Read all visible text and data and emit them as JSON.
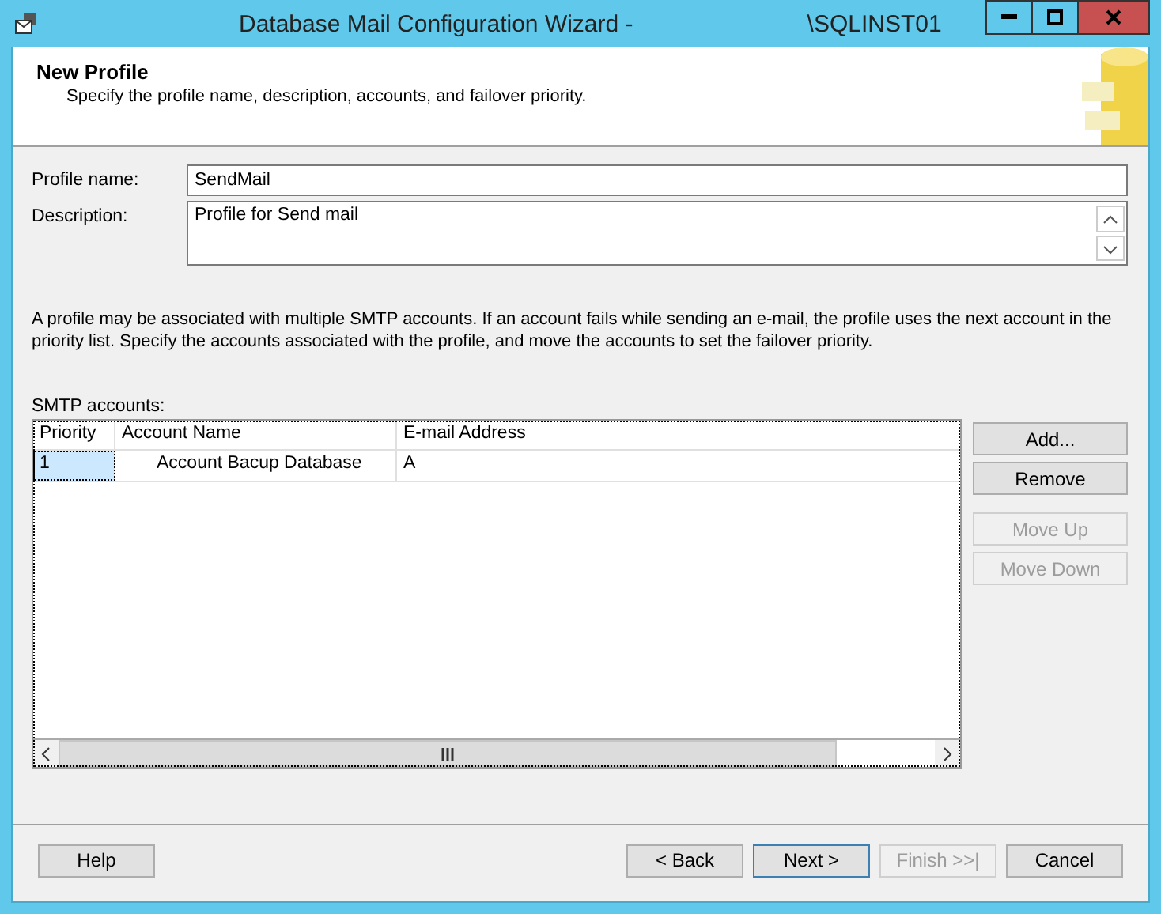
{
  "window": {
    "title": "Database Mail Configuration Wizard -",
    "server": "\\SQLINST01"
  },
  "header": {
    "title": "New Profile",
    "subtitle": "Specify the profile name, description, accounts, and failover priority."
  },
  "form": {
    "profile_name": {
      "label": "Profile name:",
      "value": "SendMail"
    },
    "description": {
      "label": "Description:",
      "value": "Profile for Send mail"
    }
  },
  "info_text": "A profile may be associated with multiple SMTP accounts. If an account fails while sending an e-mail, the profile uses the next account in the priority list. Specify the accounts associated with the profile, and move the accounts to set the failover priority.",
  "smtp_accounts": {
    "label": "SMTP accounts:",
    "columns": [
      "Priority",
      "Account Name",
      "E-mail Address"
    ],
    "rows": [
      {
        "priority": "1",
        "account_name": "Account Bacup Database",
        "email": "A",
        "selected": true
      }
    ],
    "buttons": [
      {
        "label": "Add...",
        "disabled": false
      },
      {
        "label": "Remove",
        "disabled": false
      },
      {
        "label": "Move Up",
        "disabled": true
      },
      {
        "label": "Move Down",
        "disabled": true
      }
    ]
  },
  "footer_buttons": [
    {
      "label": "Help",
      "disabled": false,
      "default": false
    },
    {
      "label": "< Back",
      "disabled": false,
      "default": false
    },
    {
      "label": "Next >",
      "disabled": false,
      "default": true
    },
    {
      "label": "Finish >>|",
      "disabled": true,
      "default": false
    },
    {
      "label": "Cancel",
      "disabled": false,
      "default": false
    }
  ]
}
